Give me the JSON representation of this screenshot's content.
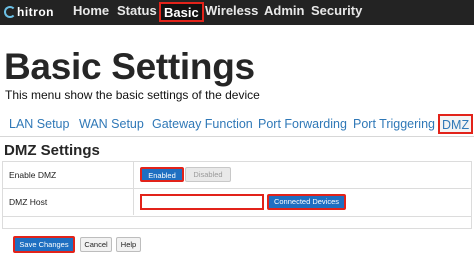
{
  "brand": {
    "name": "hitron",
    "icon": "hitron-logo-icon"
  },
  "nav": {
    "items": [
      {
        "label": "Home",
        "active": false
      },
      {
        "label": "Status",
        "active": false
      },
      {
        "label": "Basic",
        "active": true
      },
      {
        "label": "Wireless",
        "active": false
      },
      {
        "label": "Admin",
        "active": false
      },
      {
        "label": "Security",
        "active": false
      }
    ]
  },
  "page": {
    "title": "Basic Settings",
    "description": "This menu show the basic settings of the device"
  },
  "tabs": [
    {
      "label": "LAN Setup",
      "active": false
    },
    {
      "label": "WAN Setup",
      "active": false
    },
    {
      "label": "Gateway Function",
      "active": false
    },
    {
      "label": "Port Forwarding",
      "active": false
    },
    {
      "label": "Port Triggering",
      "active": false
    },
    {
      "label": "DMZ",
      "active": true
    }
  ],
  "section": {
    "title": "DMZ Settings"
  },
  "form": {
    "enable_dmz": {
      "label": "Enable DMZ",
      "enabled_label": "Enabled",
      "disabled_label": "Disabled",
      "selected": "Enabled"
    },
    "dmz_host": {
      "label": "DMZ Host",
      "value": "",
      "button_label": "Connected Devices"
    }
  },
  "actions": {
    "save": "Save Changes",
    "cancel": "Cancel",
    "help": "Help"
  },
  "colors": {
    "highlight": "#e2231a",
    "primary": "#1f6fc1",
    "topbar": "#232323",
    "link": "#2f78b7"
  }
}
